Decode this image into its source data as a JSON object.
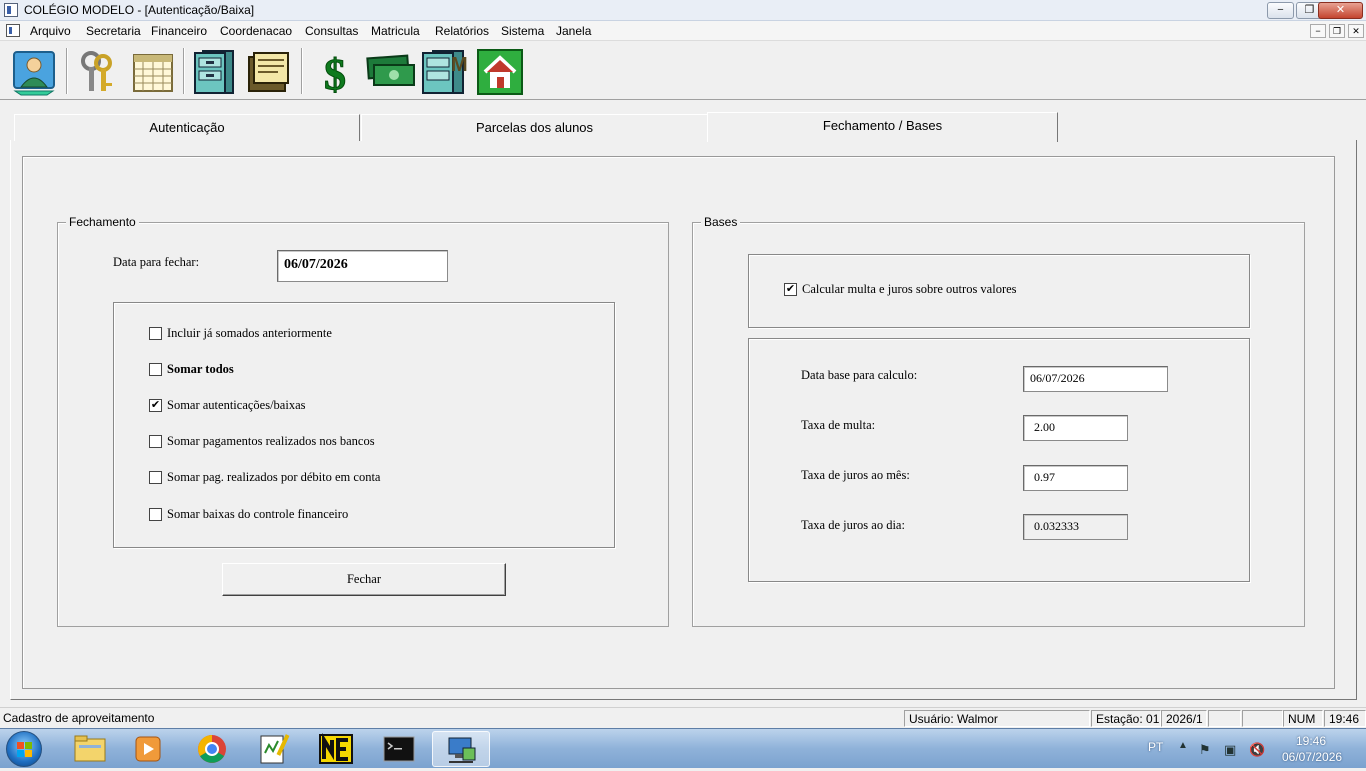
{
  "window": {
    "title": "COLÉGIO MODELO - [Autenticação/Baixa]",
    "minimize": "−",
    "restore": "❐",
    "close": "✕"
  },
  "menu": {
    "items": [
      "Arquivo",
      "Secretaria",
      "Financeiro",
      "Coordenacao",
      "Consultas",
      "Matricula",
      "Relatórios",
      "Sistema",
      "Janela"
    ],
    "mdi_minimize": "−",
    "mdi_restore": "❐",
    "mdi_close": "✕"
  },
  "toolbar": {
    "icons": [
      "person-icon",
      "keys-icon",
      "calendar-icon",
      "file-cabinet-icon",
      "documents-icon",
      "dollar-icon",
      "money-icon",
      "file-cabinet-m-icon",
      "home-icon"
    ],
    "dollar_glyph": "$",
    "m_glyph": "M"
  },
  "tabs": [
    "Autenticação",
    "Parcelas dos alunos",
    "Fechamento / Bases"
  ],
  "active_tab": "Fechamento / Bases",
  "fechamento": {
    "title": "Fechamento",
    "date_label": "Data para fechar:",
    "date_value": "06/07/2026",
    "options": [
      {
        "label": "Incluir já somados anteriormente",
        "checked": false,
        "bold": false
      },
      {
        "label": "Somar todos",
        "checked": false,
        "bold": true
      },
      {
        "label": "Somar autenticações/baixas",
        "checked": true,
        "bold": false
      },
      {
        "label": "Somar pagamentos realizados nos bancos",
        "checked": false,
        "bold": false
      },
      {
        "label": "Somar pag. realizados por débito em conta",
        "checked": false,
        "bold": false
      },
      {
        "label": "Somar baixas do controle financeiro",
        "checked": false,
        "bold": false
      }
    ],
    "button_label": "Fechar"
  },
  "bases": {
    "title": "Bases",
    "calc_option": {
      "label": "Calcular multa e juros sobre outros valores",
      "checked": true
    },
    "fields": [
      {
        "label": "Data base para calculo:",
        "value": "06/07/2026",
        "readonly": false
      },
      {
        "label": "Taxa de multa:",
        "value": "2.00",
        "readonly": false
      },
      {
        "label": "Taxa de juros ao mês:",
        "value": "0.97",
        "readonly": false
      },
      {
        "label": "Taxa de juros ao dia:",
        "value": "0.032333",
        "readonly": true
      }
    ]
  },
  "statusbar": {
    "message": "Cadastro de aproveitamento",
    "user": "Usuário: Walmor",
    "station": "Estação: 01",
    "period": "2026/1",
    "num": "NUM",
    "time": "19:46"
  },
  "taskbar": {
    "apps": [
      "explorer-icon",
      "media-player-icon",
      "chrome-icon",
      "notepad-icon",
      "ne-icon",
      "cmd-icon",
      "network-app-icon"
    ],
    "lang": "PT",
    "time": "19:46",
    "date": "06/07/2026",
    "colors": {
      "taskbar": "#8fb2d9",
      "active": "#ffffff"
    }
  }
}
